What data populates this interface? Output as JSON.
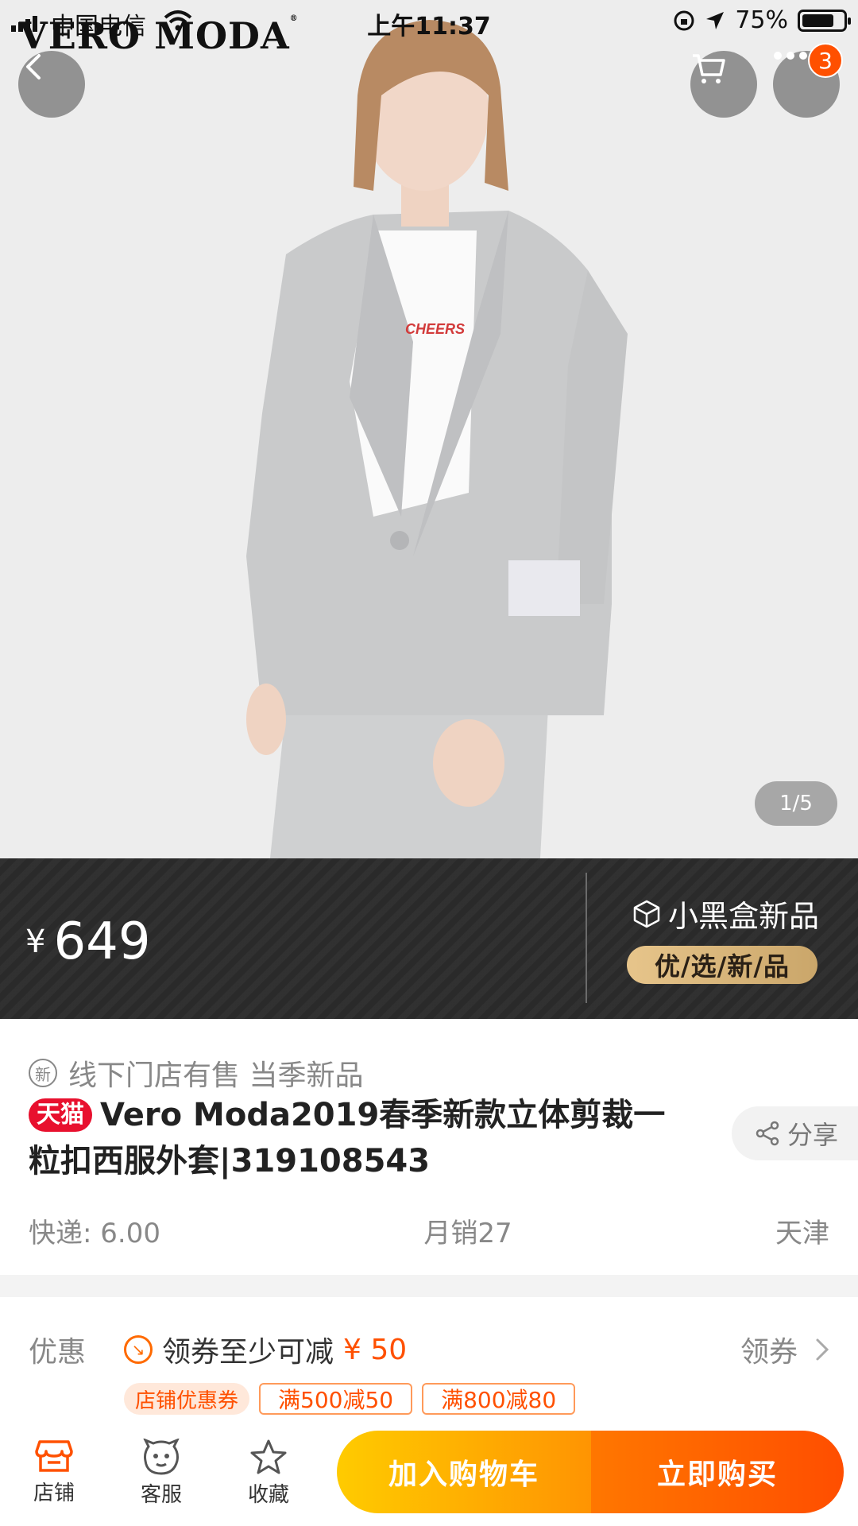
{
  "status_bar": {
    "carrier": "中国电信",
    "time": "上午11:37",
    "battery": "75%"
  },
  "hero": {
    "brand": "VERO MODA",
    "shirt_text": "CHEERS",
    "page_indicator": "1/5",
    "cart_badge_count": "3"
  },
  "price_banner": {
    "currency": "¥",
    "price": "649",
    "blackbox_title": "小黑盒新品",
    "blackbox_tag": "优/选/新/品"
  },
  "info": {
    "new_icon_text": "新",
    "new_label": "线下门店有售 当季新品",
    "tmall_badge": "天猫",
    "title": "Vero Moda2019春季新款立体剪裁一粒扣西服外套|319108543",
    "share": "分享",
    "shipping": "快递: 6.00",
    "monthly_sales": "月销27",
    "location": "天津"
  },
  "coupon": {
    "label": "优惠",
    "text": "领券至少可减",
    "amount": "¥ 50",
    "action": "领券",
    "store_tag": "店铺优惠券",
    "coupons": [
      "满500减50",
      "满800减80"
    ]
  },
  "bottom_bar": {
    "store": "店铺",
    "service": "客服",
    "favorite": "收藏",
    "add_to_cart": "加入购物车",
    "buy_now": "立即购买"
  },
  "colors": {
    "accent": "#ff5000",
    "cart_button": "#ffb300",
    "buy_button": "#ff5a00",
    "tmall_red": "#e8102e",
    "banner_bg": "#2a2a2a"
  }
}
